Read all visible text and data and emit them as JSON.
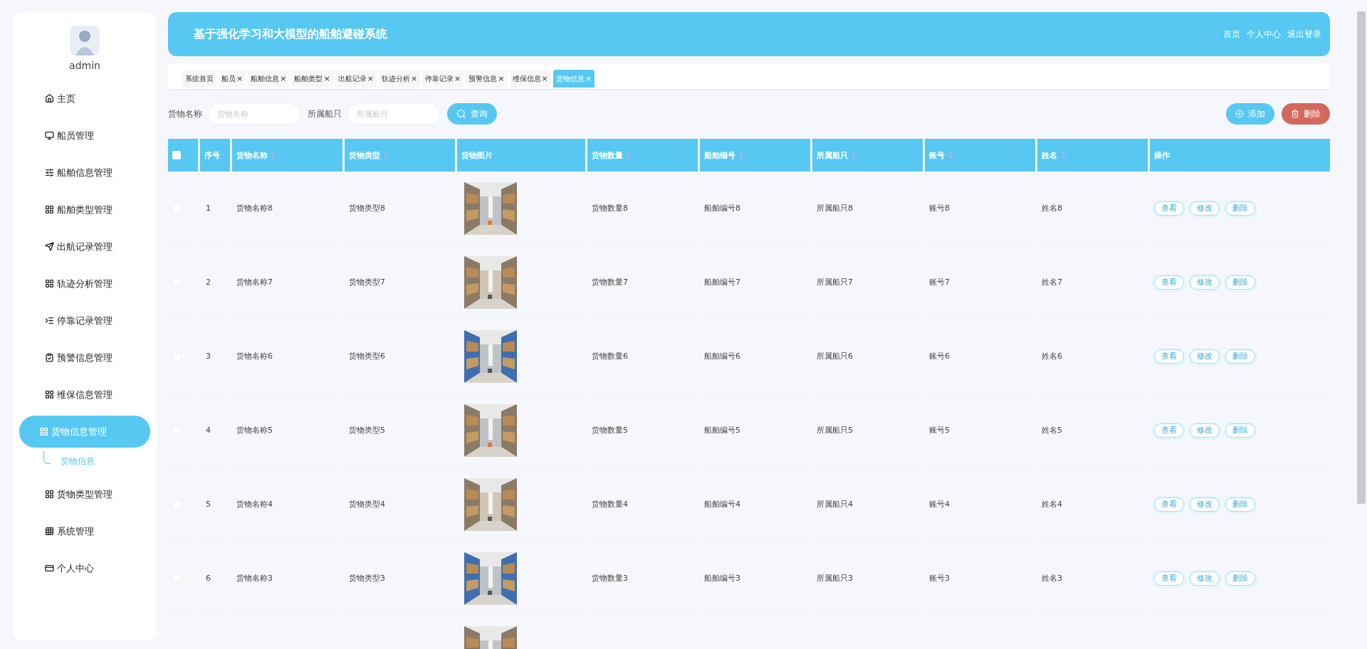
{
  "user": {
    "name": "admin"
  },
  "menu": [
    {
      "label": "主页",
      "selected": false
    },
    {
      "label": "船员管理",
      "selected": false
    },
    {
      "label": "船舶信息管理",
      "selected": false
    },
    {
      "label": "船舶类型管理",
      "selected": false
    },
    {
      "label": "出航记录管理",
      "selected": false
    },
    {
      "label": "轨迹分析管理",
      "selected": false
    },
    {
      "label": "停靠记录管理",
      "selected": false
    },
    {
      "label": "预警信息管理",
      "selected": false
    },
    {
      "label": "维保信息管理",
      "selected": false
    },
    {
      "label": "货物信息管理",
      "selected": true,
      "expanded": true,
      "children": [
        {
          "label": "货物信息",
          "selected": true
        }
      ]
    },
    {
      "label": "货物类型管理",
      "selected": false
    },
    {
      "label": "系统管理",
      "selected": false
    },
    {
      "label": "个人中心",
      "selected": false
    }
  ],
  "header": {
    "title": "基于强化学习和大模型的船舶避碰系统",
    "links": [
      "首页",
      "个人中心",
      "退出登录"
    ]
  },
  "tabs": [
    {
      "label": "系统首页",
      "closable": false,
      "selected": false
    },
    {
      "label": "船员",
      "closable": true,
      "selected": false
    },
    {
      "label": "船舶信息",
      "closable": true,
      "selected": false
    },
    {
      "label": "船舶类型",
      "closable": true,
      "selected": false
    },
    {
      "label": "出航记录",
      "closable": true,
      "selected": false
    },
    {
      "label": "轨迹分析",
      "closable": true,
      "selected": false
    },
    {
      "label": "停靠记录",
      "closable": true,
      "selected": false
    },
    {
      "label": "预警信息",
      "closable": true,
      "selected": false
    },
    {
      "label": "维保信息",
      "closable": true,
      "selected": false
    },
    {
      "label": "货物信息",
      "closable": true,
      "selected": true
    }
  ],
  "close_mark": "×",
  "search": {
    "fields": [
      {
        "label": "货物名称",
        "placeholder": "货物名称"
      },
      {
        "label": "所属船只",
        "placeholder": "所属船只"
      }
    ],
    "button": "查询",
    "add": "添加",
    "delete": "删除"
  },
  "table": {
    "header_checked": false,
    "columns": [
      {
        "label": "序号",
        "sortable": false
      },
      {
        "label": "货物名称",
        "sortable": true
      },
      {
        "label": "货物类型",
        "sortable": true
      },
      {
        "label": "货物图片",
        "sortable": false
      },
      {
        "label": "货物数量",
        "sortable": true
      },
      {
        "label": "船舶编号",
        "sortable": true
      },
      {
        "label": "所属船只",
        "sortable": true
      },
      {
        "label": "账号",
        "sortable": true
      },
      {
        "label": "姓名",
        "sortable": true
      },
      {
        "label": "操作",
        "sortable": false
      }
    ],
    "rows": [
      {
        "checked": false,
        "cells": [
          "1",
          "货物名称8",
          "货物类型8",
          {
            "kind": "picture"
          },
          "货物数量8",
          "船舶编号8",
          "所属船只8",
          "账号8",
          "姓名8"
        ],
        "actions": [
          "查看",
          "修改",
          "删除"
        ]
      },
      {
        "checked": false,
        "cells": [
          "2",
          "货物名称7",
          "货物类型7",
          {
            "kind": "picture"
          },
          "货物数量7",
          "船舶编号7",
          "所属船只7",
          "账号7",
          "姓名7"
        ],
        "actions": [
          "查看",
          "修改",
          "删除"
        ]
      },
      {
        "checked": false,
        "cells": [
          "3",
          "货物名称6",
          "货物类型6",
          {
            "kind": "picture"
          },
          "货物数量6",
          "船舶编号6",
          "所属船只6",
          "账号6",
          "姓名6"
        ],
        "actions": [
          "查看",
          "修改",
          "删除"
        ]
      },
      {
        "checked": false,
        "cells": [
          "4",
          "货物名称5",
          "货物类型5",
          {
            "kind": "picture"
          },
          "货物数量5",
          "船舶编号5",
          "所属船只5",
          "账号5",
          "姓名5"
        ],
        "actions": [
          "查看",
          "修改",
          "删除"
        ]
      },
      {
        "checked": false,
        "cells": [
          "5",
          "货物名称4",
          "货物类型4",
          {
            "kind": "picture"
          },
          "货物数量4",
          "船舶编号4",
          "所属船只4",
          "账号4",
          "姓名4"
        ],
        "actions": [
          "查看",
          "修改",
          "删除"
        ]
      },
      {
        "checked": false,
        "cells": [
          "6",
          "货物名称3",
          "货物类型3",
          {
            "kind": "picture"
          },
          "货物数量3",
          "船舶编号3",
          "所属船只3",
          "账号3",
          "姓名3"
        ],
        "actions": [
          "查看",
          "修改",
          "删除"
        ]
      },
      {
        "cells": [
          "",
          "",
          "",
          {
            "kind": "picture"
          }
        ]
      }
    ]
  }
}
